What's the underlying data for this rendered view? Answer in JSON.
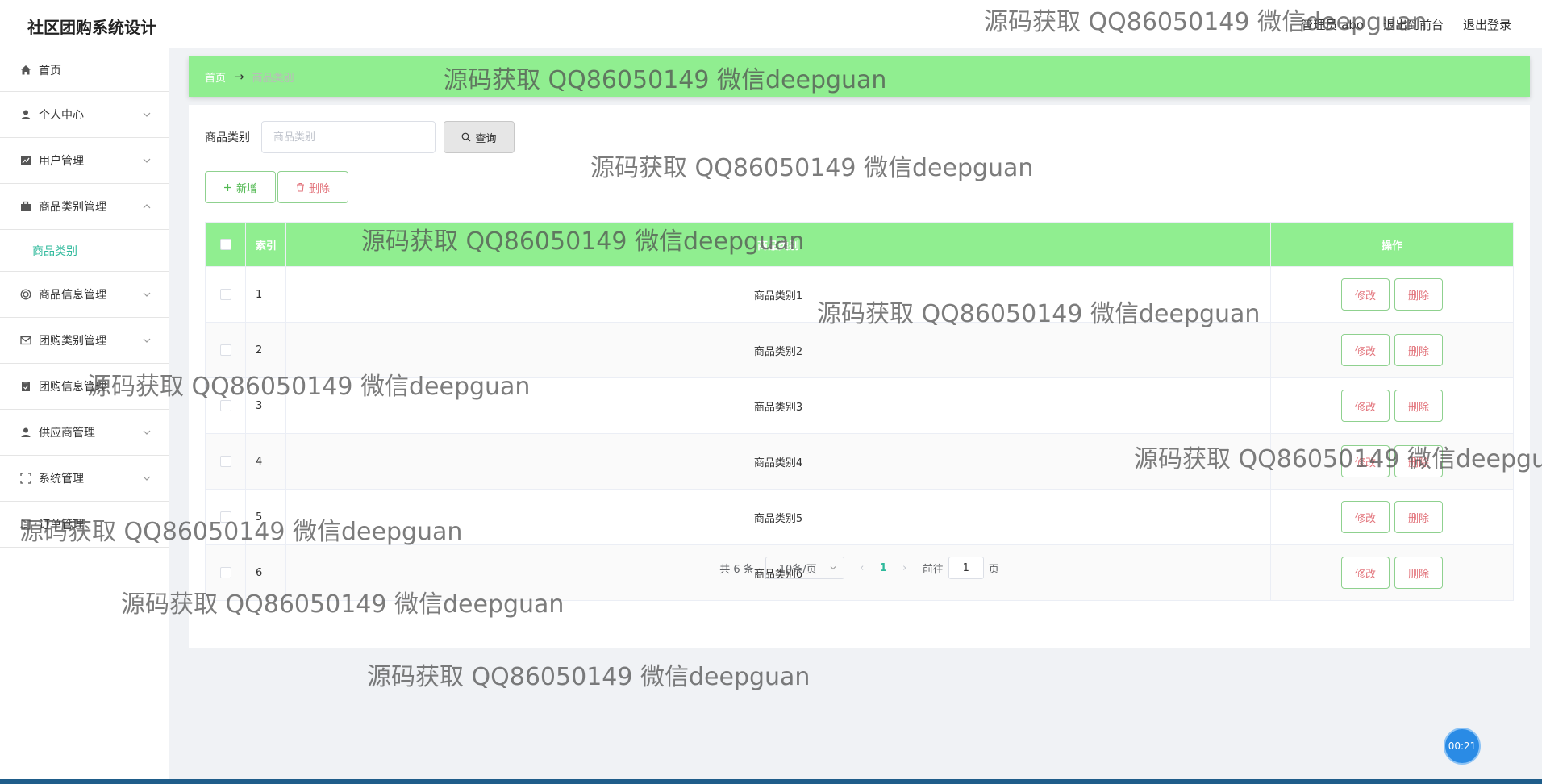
{
  "header": {
    "title": "社区团购系统设计",
    "user": "管理员 abo",
    "front_link": "退出到前台",
    "logout": "退出登录"
  },
  "sidebar": {
    "items": [
      {
        "label": "首页",
        "icon": "home-icon"
      },
      {
        "label": "个人中心",
        "icon": "user-icon"
      },
      {
        "label": "用户管理",
        "icon": "chart-icon"
      },
      {
        "label": "商品类别管理",
        "icon": "briefcase-icon",
        "expanded": true
      },
      {
        "label": "商品信息管理",
        "icon": "circle-icon"
      },
      {
        "label": "团购类别管理",
        "icon": "mail-icon"
      },
      {
        "label": "团购信息管理",
        "icon": "clipboard-icon"
      },
      {
        "label": "供应商管理",
        "icon": "user-icon"
      },
      {
        "label": "系统管理",
        "icon": "expand-icon"
      }
    ],
    "sub_item": "商品类别",
    "tail_item": "订单管理"
  },
  "breadcrumb": {
    "home": "首页",
    "arrow": "→",
    "current": "商品类别"
  },
  "search": {
    "label": "商品类别",
    "placeholder": "商品类别",
    "query_button": "查询"
  },
  "actions": {
    "add": "新增",
    "delete": "删除"
  },
  "table": {
    "columns": [
      "索引",
      "商品类别",
      "操作"
    ],
    "rows": [
      {
        "index": "1",
        "name": "商品类别1"
      },
      {
        "index": "2",
        "name": "商品类别2"
      },
      {
        "index": "3",
        "name": "商品类别3"
      },
      {
        "index": "4",
        "name": "商品类别4"
      },
      {
        "index": "5",
        "name": "商品类别5"
      },
      {
        "index": "6",
        "name": "商品类别6"
      }
    ],
    "edit_label": "修改",
    "delete_label": "删除"
  },
  "pagination": {
    "total": "共 6 条",
    "page_size": "10条/页",
    "prev": "‹",
    "current": "1",
    "next": "›",
    "goto_prefix": "前往",
    "goto_value": "1",
    "goto_suffix": "页"
  },
  "watermark": "源码获取 QQ86050149 微信deepguan",
  "timer": "00:21",
  "colors": {
    "accent_green": "#90ee90",
    "active_teal": "#2db99b",
    "danger_text": "#e2727a"
  }
}
